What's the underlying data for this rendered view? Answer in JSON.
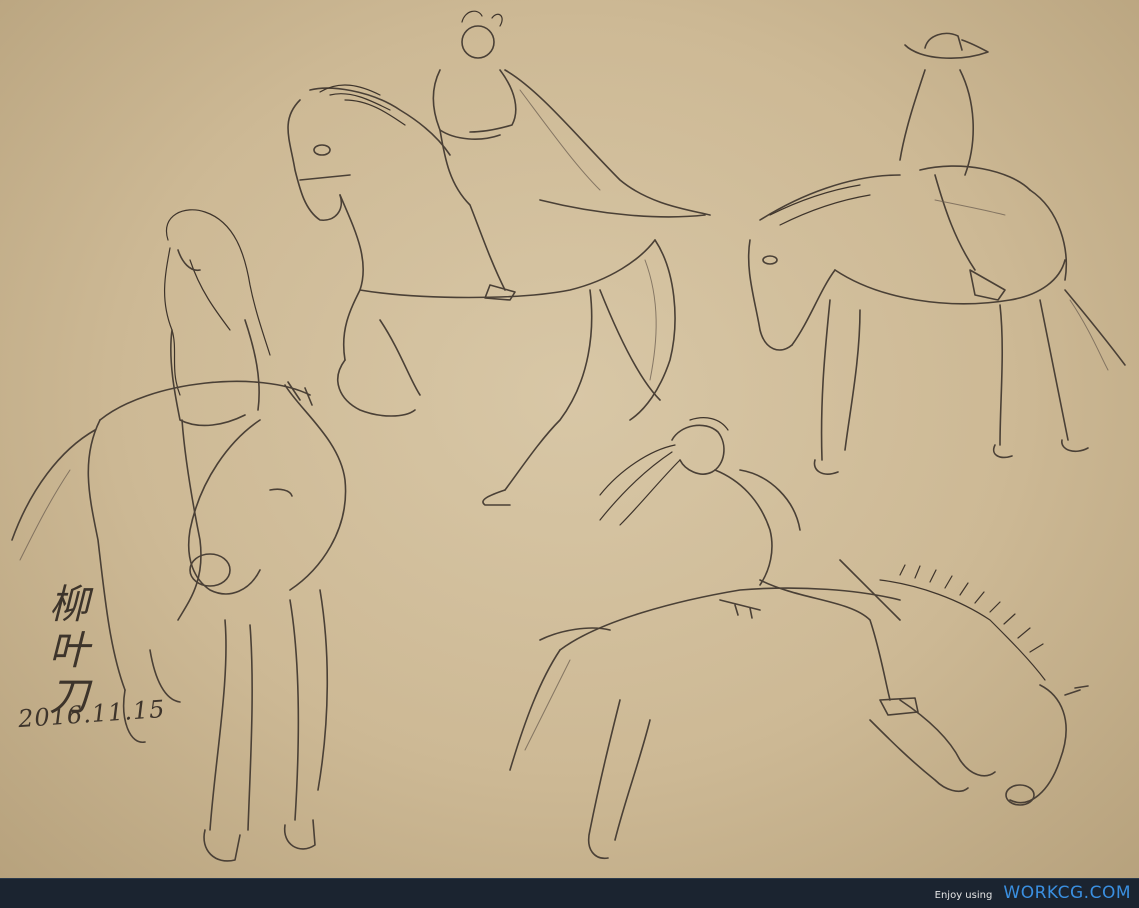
{
  "artwork": {
    "signature": [
      "柳",
      "叶",
      "刀"
    ],
    "date": "2016.11.15",
    "colors": {
      "paper": "#cdb995",
      "ink": "#4a4036",
      "footer": "#1b2430",
      "brand": "#3a8fe0"
    }
  },
  "footer": {
    "enjoy_text": "Enjoy using",
    "brand_text": "WORKCG.COM"
  }
}
